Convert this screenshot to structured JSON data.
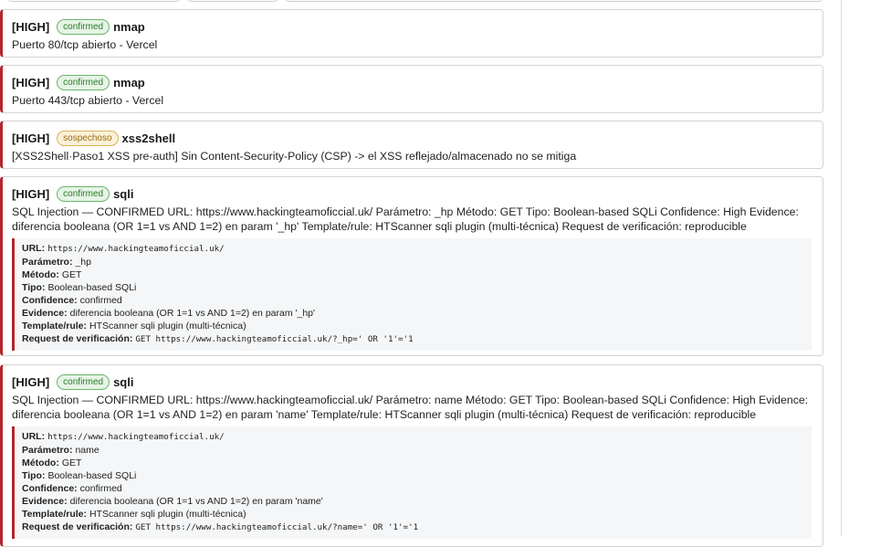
{
  "findings": [
    {
      "severity": "[HIGH]",
      "status": "confirmed",
      "tool": "nmap",
      "description": "Puerto 80/tcp abierto - Vercel"
    },
    {
      "severity": "[HIGH]",
      "status": "confirmed",
      "tool": "nmap",
      "description": "Puerto 443/tcp abierto - Vercel"
    },
    {
      "severity": "[HIGH]",
      "status": "sospechoso",
      "tool": "xss2shell",
      "description": "[XSS2Shell·Paso1 XSS pre-auth] Sin Content-Security-Policy (CSP) -> el XSS reflejado/almacenado no se mitiga"
    },
    {
      "severity": "[HIGH]",
      "status": "confirmed",
      "tool": "sqli",
      "description": "SQL Injection — CONFIRMED URL: https://www.hackingteamoficcial.uk/ Parámetro: _hp Método: GET Tipo: Boolean-based SQLi Confidence: High Evidence: diferencia booleana (OR 1=1 vs AND 1=2) en param '_hp' Template/rule: HTScanner sqli plugin (multi-técnica) Request de verificación: reproducible",
      "details": {
        "url_label": "URL:",
        "url": "https://www.hackingteamoficcial.uk/",
        "param_label": "Parámetro:",
        "param": "_hp",
        "method_label": "Método:",
        "method": "GET",
        "type_label": "Tipo:",
        "type": "Boolean-based SQLi",
        "confidence_label": "Confidence:",
        "confidence": "confirmed",
        "evidence_label": "Evidence:",
        "evidence": "diferencia booleana (OR 1=1 vs AND 1=2) en param '_hp'",
        "template_label": "Template/rule:",
        "template": "HTScanner sqli plugin (multi-técnica)",
        "request_label": "Request de verificación:",
        "request": "GET https://www.hackingteamoficcial.uk/?_hp=' OR '1'='1"
      }
    },
    {
      "severity": "[HIGH]",
      "status": "confirmed",
      "tool": "sqli",
      "description": "SQL Injection — CONFIRMED URL: https://www.hackingteamoficcial.uk/ Parámetro: name Método: GET Tipo: Boolean-based SQLi Confidence: High Evidence: diferencia booleana (OR 1=1 vs AND 1=2) en param 'name' Template/rule: HTScanner sqli plugin (multi-técnica) Request de verificación: reproducible",
      "details": {
        "url_label": "URL:",
        "url": "https://www.hackingteamoficcial.uk/",
        "param_label": "Parámetro:",
        "param": "name",
        "method_label": "Método:",
        "method": "GET",
        "type_label": "Tipo:",
        "type": "Boolean-based SQLi",
        "confidence_label": "Confidence:",
        "confidence": "confirmed",
        "evidence_label": "Evidence:",
        "evidence": "diferencia booleana (OR 1=1 vs AND 1=2) en param 'name'",
        "template_label": "Template/rule:",
        "template": "HTScanner sqli plugin (multi-técnica)",
        "request_label": "Request de verificación:",
        "request": "GET https://www.hackingteamoficcial.uk/?name=' OR '1'='1"
      }
    }
  ],
  "colors": {
    "severity_high": "#b3262d",
    "badge_confirmed": "#2b7a2b",
    "badge_sospechoso": "#9a6a12"
  }
}
